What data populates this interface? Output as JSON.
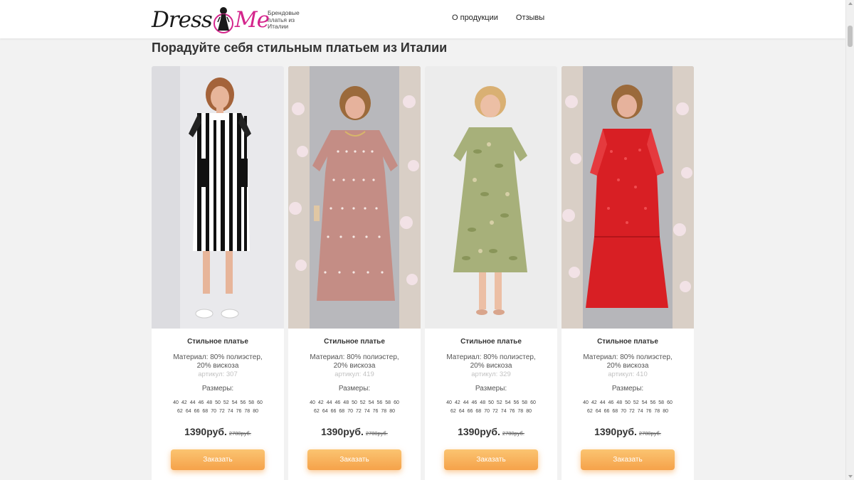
{
  "header": {
    "logo_left": "Dress",
    "logo_right": "Me",
    "tagline": "Брендовые платья из Италии",
    "nav": [
      "О продукции",
      "Отзывы"
    ]
  },
  "page_title": "Порадуйте себя стильным платьем из Италии",
  "sizes_row1": [
    "40",
    "42",
    "44",
    "46",
    "48",
    "50",
    "52",
    "54",
    "56",
    "58",
    "60"
  ],
  "sizes_row2": [
    "62",
    "64",
    "66",
    "68",
    "70",
    "72",
    "74",
    "76",
    "78",
    "80"
  ],
  "colors": {
    "brand_pink": "#d4258c",
    "button_orange": "#f5a24a"
  },
  "products": [
    {
      "title": "Стильное платье",
      "material": "Материал: 80% полиэстер, 20% вискоза",
      "article": "артикул: 307",
      "sizes_label": "Размеры:",
      "price": "1390руб.",
      "old_price": "2780руб.",
      "button": "Заказать",
      "photo": "black-white-striped-dress"
    },
    {
      "title": "Стильное платье",
      "material": "Материал: 80% полиэстер, 20% вискоза",
      "article": "артикул: 419",
      "sizes_label": "Размеры:",
      "price": "1390руб.",
      "old_price": "2780руб.",
      "button": "Заказать",
      "photo": "pink-polka-dot-dress"
    },
    {
      "title": "Стильное платье",
      "material": "Материал: 80% полиэстер, 20% вискоза",
      "article": "артикул: 329",
      "sizes_label": "Размеры:",
      "price": "1390руб.",
      "old_price": "2780руб.",
      "button": "Заказать",
      "photo": "green-floral-dress"
    },
    {
      "title": "Стильное платье",
      "material": "Материал: 80% полиэстер, 20% вискоза",
      "article": "артикул: 410",
      "sizes_label": "Размеры:",
      "price": "1390руб.",
      "old_price": "2780руб.",
      "button": "Заказать",
      "photo": "red-lace-dress"
    }
  ]
}
